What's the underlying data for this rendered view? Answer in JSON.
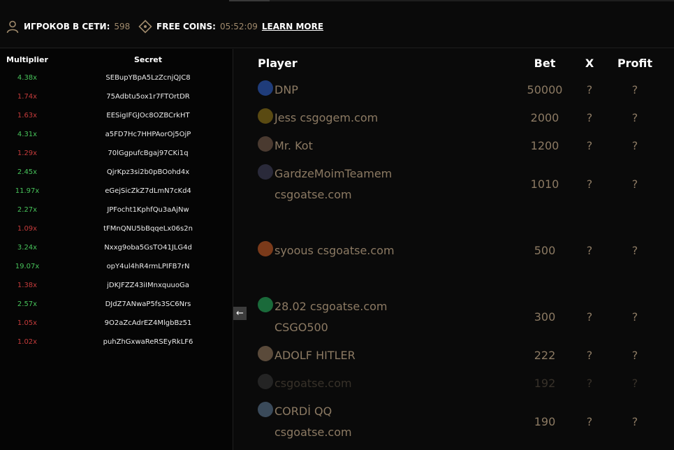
{
  "header": {
    "online_label": "ИГРОКОВ В СЕТИ:",
    "online_count": "598",
    "coins_label": "FREE COINS:",
    "coins_timer": "05:52:09",
    "learn_more": "LEARN MORE"
  },
  "history": {
    "col_multiplier": "Multiplier",
    "col_secret": "Secret",
    "rows": [
      {
        "multiplier": "4.38x",
        "secret": "SEBupYBpA5LzZcnjQJC8",
        "trend": "up"
      },
      {
        "multiplier": "1.74x",
        "secret": "75Adbtu5ox1r7FTOrtDR",
        "trend": "down"
      },
      {
        "multiplier": "1.63x",
        "secret": "EESigIFGJOc8OZBCrkHT",
        "trend": "down"
      },
      {
        "multiplier": "4.31x",
        "secret": "a5FD7Hc7HHPAorOj5OjP",
        "trend": "up"
      },
      {
        "multiplier": "1.29x",
        "secret": "70lGgpufcBgaj97CKi1q",
        "trend": "down"
      },
      {
        "multiplier": "2.45x",
        "secret": "QjrKpz3si2b0pBOohd4x",
        "trend": "up"
      },
      {
        "multiplier": "11.97x",
        "secret": "eGejSicZkZ7dLmN7cKd4",
        "trend": "up"
      },
      {
        "multiplier": "2.27x",
        "secret": "JPFocht1KphfQu3aAjNw",
        "trend": "up"
      },
      {
        "multiplier": "1.09x",
        "secret": "tFMnQNU5bBqqeLx06s2n",
        "trend": "down"
      },
      {
        "multiplier": "3.24x",
        "secret": "Nxxg9oba5GsTO41JLG4d",
        "trend": "up"
      },
      {
        "multiplier": "19.07x",
        "secret": "opY4ul4hR4rmLPIFB7rN",
        "trend": "up"
      },
      {
        "multiplier": "1.38x",
        "secret": "jDKJFZZ43iIMnxquuoGa",
        "trend": "down"
      },
      {
        "multiplier": "2.57x",
        "secret": "DJdZ7ANwaP5fs3SC6Nrs",
        "trend": "up"
      },
      {
        "multiplier": "1.05x",
        "secret": "9O2aZcAdrEZ4MlgbBz51",
        "trend": "down"
      },
      {
        "multiplier": "1.02x",
        "secret": "puhZhGxwaReRSEyRkLF6",
        "trend": "down"
      }
    ]
  },
  "toggle_label": "←",
  "bets": {
    "col_player": "Player",
    "col_bet": "Bet",
    "col_x": "X",
    "col_profit": "Profit",
    "rows": [
      {
        "name": "DNP",
        "name2": "",
        "bet": "50000",
        "x": "?",
        "profit": "?",
        "avatar_color": "#1f3c7a",
        "state": "normal"
      },
      {
        "name": "Jess csgogem.com",
        "name2": "",
        "bet": "2000",
        "x": "?",
        "profit": "?",
        "avatar_color": "#5a4a12",
        "state": "normal"
      },
      {
        "name": "Mr. Kot",
        "name2": "",
        "bet": "1200",
        "x": "?",
        "profit": "?",
        "avatar_color": "#4a3a30",
        "state": "normal"
      },
      {
        "name": "GardzeMoimTeamem",
        "name2": "csgoatse.com",
        "bet": "1010",
        "x": "?",
        "profit": "?",
        "avatar_color": "#2a2a3a",
        "state": "normal"
      },
      {
        "name": "syoous csgoatse.com",
        "name2": "",
        "bet": "500",
        "x": "?",
        "profit": "?",
        "avatar_color": "#7a3a1a",
        "state": "normal"
      },
      {
        "name": "28.02 csgoatse.com",
        "name2": "CSGO500",
        "bet": "300",
        "x": "?",
        "profit": "?",
        "avatar_color": "#1a6a3a",
        "state": "normal"
      },
      {
        "name": "ADOLF HITLER",
        "name2": "",
        "bet": "222",
        "x": "?",
        "profit": "?",
        "avatar_color": "#5a4a3a",
        "state": "normal"
      },
      {
        "name": "csgoatse.com",
        "name2": "",
        "bet": "192",
        "x": "?",
        "profit": "?",
        "avatar_color": "#555555",
        "state": "faded"
      },
      {
        "name": "CORDİ QQ",
        "name2": "csgoatse.com",
        "bet": "190",
        "x": "?",
        "profit": "?",
        "avatar_color": "#3a4a5a",
        "state": "normal"
      }
    ]
  }
}
